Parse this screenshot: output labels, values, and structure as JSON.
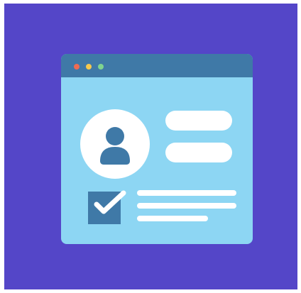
{
  "colors": {
    "background": "#5446c8",
    "window_body": "#8dd6f3",
    "title_bar": "#3f79a7",
    "dot_red": "#ee6b52",
    "dot_yellow": "#f5c94e",
    "dot_green": "#7fd48f",
    "avatar_figure": "#3f79a7",
    "checkbox_fill": "#3f79a7",
    "check_mark": "#ffffff",
    "placeholder": "#ffffff"
  },
  "icons": {
    "window": "browser-window-icon",
    "avatar": "user-avatar-icon",
    "checkbox": "checked-checkbox-icon"
  },
  "checkbox": {
    "checked": true
  }
}
